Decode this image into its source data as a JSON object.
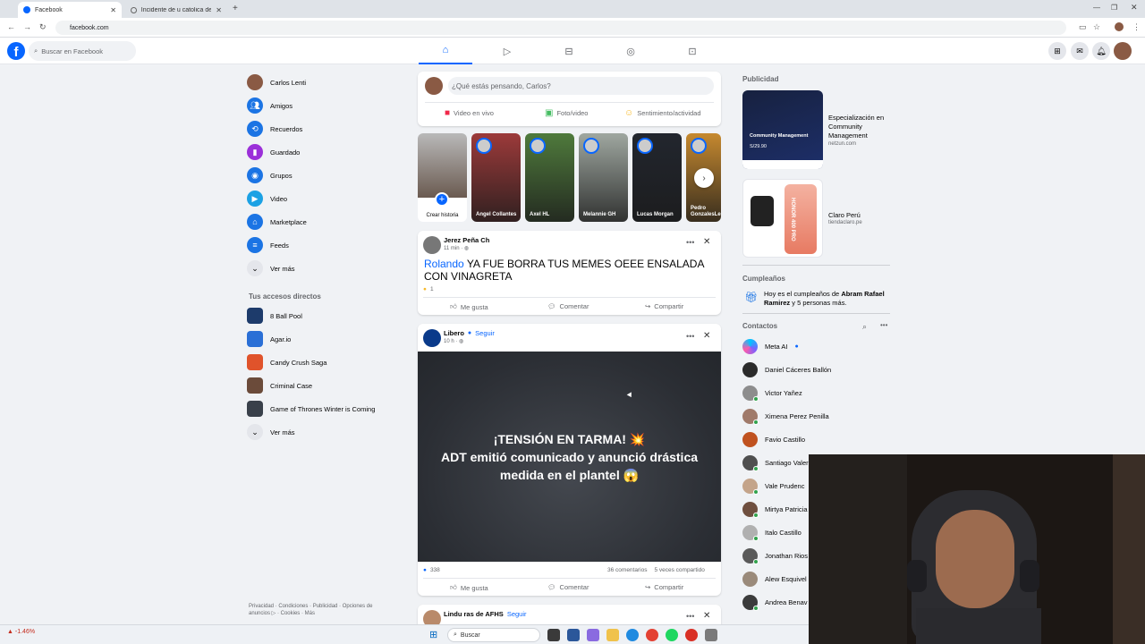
{
  "browser": {
    "tabs": [
      {
        "title": "Facebook",
        "active": true
      },
      {
        "title": "Incidente de u catolica de chile",
        "active": false
      }
    ],
    "url": "facebook.com"
  },
  "header": {
    "search_placeholder": "Buscar en Facebook"
  },
  "sidebar": {
    "items": [
      {
        "label": "Carlos Lenti",
        "icon": "profile-avatar",
        "color": "#8a5a44"
      },
      {
        "label": "Amigos",
        "icon": "friends-icon",
        "color": "#1b74e4"
      },
      {
        "label": "Recuerdos",
        "icon": "memories-icon",
        "color": "#1b74e4"
      },
      {
        "label": "Guardado",
        "icon": "bookmark-icon",
        "color": "#9b30d9"
      },
      {
        "label": "Grupos",
        "icon": "groups-icon",
        "color": "#1b74e4"
      },
      {
        "label": "Video",
        "icon": "video-icon",
        "color": "#1ba1e4"
      },
      {
        "label": "Marketplace",
        "icon": "shop-icon",
        "color": "#1b74e4"
      },
      {
        "label": "Feeds",
        "icon": "feeds-icon",
        "color": "#1b74e4"
      },
      {
        "label": "Ver más",
        "icon": "chevron-down-icon",
        "color": "#e4e6eb"
      }
    ],
    "shortcuts_title": "Tus accesos directos",
    "shortcuts": [
      {
        "label": "8 Ball Pool",
        "color": "#1d3b6b"
      },
      {
        "label": "Agar.io",
        "color": "#2a6fd6"
      },
      {
        "label": "Candy Crush Saga",
        "color": "#e0532b"
      },
      {
        "label": "Criminal Case",
        "color": "#6b4b3a"
      },
      {
        "label": "Game of Thrones Winter is Coming",
        "color": "#39404a"
      },
      {
        "label": "Ver más",
        "color": "#e4e6eb"
      }
    ],
    "footer": "Privacidad · Condiciones · Publicidad · Opciones de anuncios ▷ · Cookies · Más"
  },
  "composer": {
    "placeholder": "¿Qué estás pensando, Carlos?",
    "live_label": "Video en vivo",
    "photo_label": "Foto/video",
    "feeling_label": "Sentimiento/actividad"
  },
  "stories": [
    {
      "name": "Crear historia",
      "color": "#c9c9c9"
    },
    {
      "name": "Angel Collantes",
      "color": "#9c3a3a"
    },
    {
      "name": "Axel HL",
      "color": "#4f7a3c"
    },
    {
      "name": "Melannie GH",
      "color": "#9fa7a0"
    },
    {
      "name": "Lucas Morgan",
      "color": "#22262e"
    },
    {
      "name": "Pedro GonzalesLe",
      "color": "#c6892f"
    }
  ],
  "posts": [
    {
      "author": "Jerez Peña Ch",
      "time": "11 min · ",
      "mention": "Rolando",
      "text": " YA FUE BORRA TUS MEMES OEEE ENSALADA CON VINAGRETA",
      "reactions": "1",
      "like": "Me gusta",
      "comment": "Comentar",
      "share": "Compartir"
    },
    {
      "author": "Libero",
      "follow": "Seguir",
      "time": "10 h · ",
      "headline1": "¡TENSIÓN EN TARMA! 💥",
      "headline2": "ADT emitió comunicado y anunció drástica",
      "headline3": "medida en el plantel 😱",
      "reactions": "338",
      "comments": "36 comentarios",
      "shares": "5 veces compartido",
      "like": "Me gusta",
      "comment": "Comentar",
      "share": "Compartir"
    },
    {
      "author": "Lindu ras de AFHS",
      "follow": "Seguir"
    }
  ],
  "right": {
    "ads_title": "Publicidad",
    "ads": [
      {
        "title": "Especialización en Community Management",
        "domain": "netzun.com",
        "img_title": "Community Management",
        "price": "S/29.90"
      },
      {
        "title": "Claro Perú",
        "domain": "tiendaclaro.pe",
        "img_title": "HONOR 400 PRO"
      }
    ],
    "birthdays_title": "Cumpleaños",
    "birthday_pre": "Hoy es el cumpleaños de ",
    "birthday_name": "Abram Rafael Ramirez",
    "birthday_post": " y 5 personas más.",
    "contacts_title": "Contactos",
    "contacts": [
      {
        "name": "Meta AI",
        "color": "#7b61ff",
        "online": false
      },
      {
        "name": "Daniel Cáceres Ballón",
        "color": "#2b2b2b",
        "online": false
      },
      {
        "name": "Victor Yañez",
        "color": "#8d8d8d",
        "online": true
      },
      {
        "name": "Ximena Perez Penilla",
        "color": "#a07a6a",
        "online": true
      },
      {
        "name": "Favio Castillo",
        "color": "#c0521f",
        "online": false
      },
      {
        "name": "Santiago Valer",
        "color": "#4f4f4f",
        "online": true
      },
      {
        "name": "Vale Prudenc",
        "color": "#c4a48a",
        "online": true
      },
      {
        "name": "Mirtya Patricia",
        "color": "#6f4f3f",
        "online": true
      },
      {
        "name": "Italo Castillo",
        "color": "#b0b0b0",
        "online": true
      },
      {
        "name": "Jonathan Rios",
        "color": "#5a5a5a",
        "online": true
      },
      {
        "name": "Alew Esquivel",
        "color": "#9a8a7a",
        "online": false
      },
      {
        "name": "Andrea Benav",
        "color": "#3b3b3b",
        "online": true
      }
    ]
  },
  "taskbar": {
    "search": "Buscar",
    "stock": "-1.46%"
  }
}
